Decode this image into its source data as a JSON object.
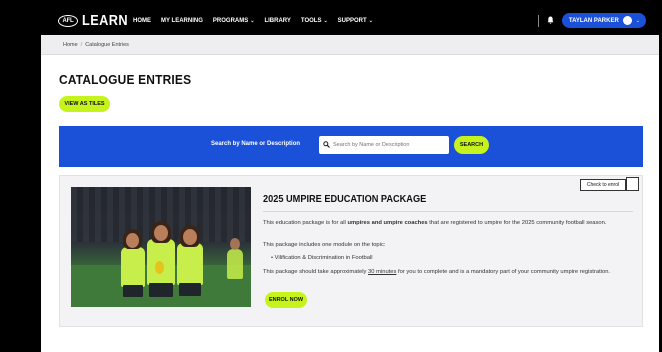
{
  "nav": {
    "logo_badge": "AFL",
    "logo_text": "LEARN",
    "items": [
      {
        "label": "HOME",
        "dropdown": false
      },
      {
        "label": "MY LEARNING",
        "dropdown": false
      },
      {
        "label": "PROGRAMS",
        "dropdown": true
      },
      {
        "label": "LIBRARY",
        "dropdown": false
      },
      {
        "label": "TOOLS",
        "dropdown": true
      },
      {
        "label": "SUPPORT",
        "dropdown": true
      }
    ],
    "user_name": "TAYLAN PARKER",
    "bell_icon": "bell-icon",
    "caret": "⌄"
  },
  "breadcrumb": {
    "home": "Home",
    "separator": "/",
    "current": "Catalogue Entries"
  },
  "page": {
    "title": "CATALOGUE ENTRIES",
    "view_tiles_label": "VIEW AS TILES"
  },
  "search": {
    "label": "Search by Name or Description",
    "placeholder": "Search by Name or Description",
    "button_label": "SEARCH"
  },
  "card": {
    "title": "2025 UMPIRE EDUCATION PACKAGE",
    "check_enrol": "Check to enrol",
    "p1_a": "This education package is for all ",
    "p1_b": "umpires and umpire coaches",
    "p1_c": " that are registered to umpire for the 2025 community football season.",
    "p2": "This package includes one module on the topic:",
    "bullet": "•",
    "p3": "Vilification & Discrimination in Football",
    "p4_a": "This package should take approximately ",
    "p4_b": "30 minutes",
    "p4_c": " for you to complete and is a mandatory part of your community umpire registration.",
    "enrol_label": "ENROL NOW"
  },
  "colors": {
    "brand_blue": "#1b50d8",
    "accent_lime": "#c6f31c",
    "nav_black": "#000000"
  }
}
